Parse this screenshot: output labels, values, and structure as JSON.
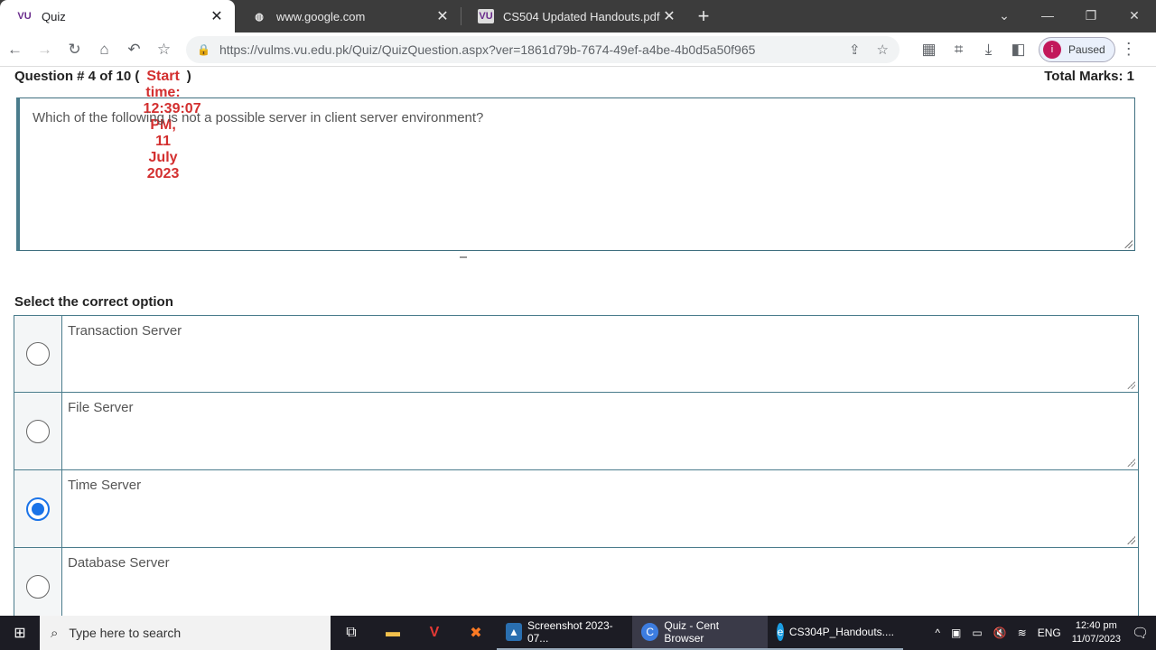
{
  "browser": {
    "tabs": [
      {
        "favicon": "VU",
        "title": "Quiz",
        "active": true
      },
      {
        "favicon": "globe-icon",
        "title": "www.google.com",
        "active": false
      },
      {
        "favicon": "VU",
        "title": "CS504 Updated Handouts.pdf",
        "active": false
      }
    ],
    "url_prefix": "https://",
    "url": "https://vulms.vu.edu.pk/Quiz/QuizQuestion.aspx?ver=1861d79b-7674-49ef-a4be-4b0d5a50f965",
    "profile_initial": "i",
    "profile_status": "Paused"
  },
  "quiz": {
    "question_number": "Question # 4 of 10",
    "open_paren": "(",
    "start_time": "Start time: 12:39:07 PM, 11 July 2023",
    "close_paren": ")",
    "total_marks": "Total Marks: 1",
    "question_text": "Which of the following is not a possible server in client server environment?",
    "select_label": "Select the correct option",
    "options": [
      {
        "label": "Transaction Server",
        "selected": false
      },
      {
        "label": "File Server",
        "selected": false
      },
      {
        "label": "Time Server",
        "selected": true
      },
      {
        "label": "Database Server",
        "selected": false
      }
    ]
  },
  "taskbar": {
    "search_placeholder": "Type here to search",
    "apps": [
      {
        "label": "Screenshot 2023-07..."
      },
      {
        "label": "Quiz - Cent Browser"
      },
      {
        "label": "CS304P_Handouts...."
      }
    ],
    "language": "ENG",
    "time": "12:40 pm",
    "date": "11/07/2023"
  }
}
